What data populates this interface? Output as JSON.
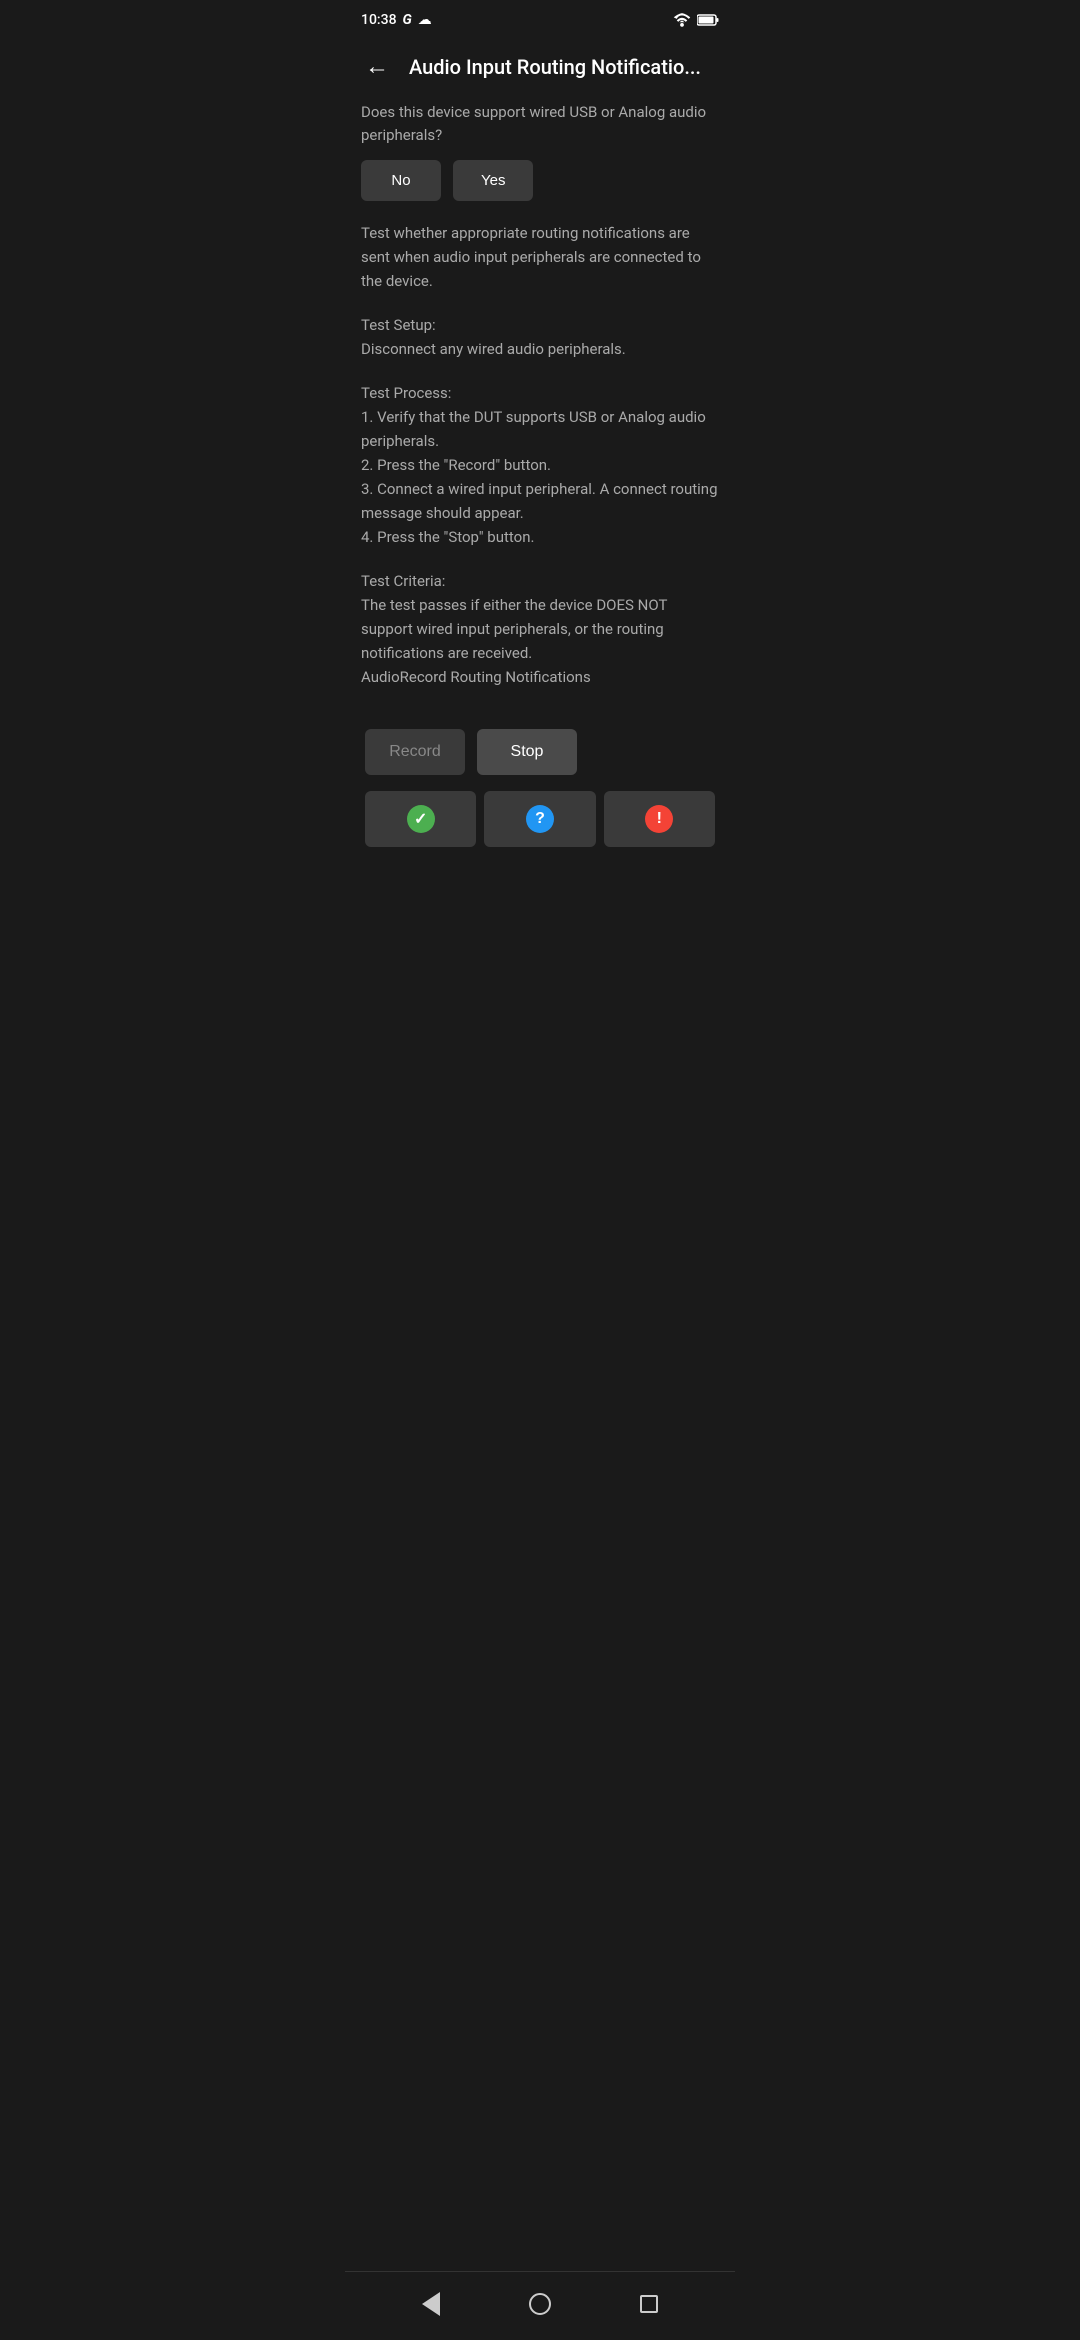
{
  "statusBar": {
    "time": "10:38",
    "googleLabel": "G",
    "cloudLabel": "☁"
  },
  "header": {
    "backLabel": "←",
    "title": "Audio Input Routing Notificatio..."
  },
  "content": {
    "questionText": "Does this device support wired USB or Analog audio peripherals?",
    "noButtonLabel": "No",
    "yesButtonLabel": "Yes",
    "descriptionText": "Test whether appropriate routing notifications are sent when audio input peripherals are connected to the device.",
    "testSetupLabel": "Test Setup:",
    "testSetupText": "Disconnect any wired audio peripherals.",
    "testProcessLabel": "Test Process:",
    "testProcessSteps": [
      "1. Verify that the DUT supports USB or Analog audio peripherals.",
      "2. Press the \"Record\" button.",
      "3. Connect a wired input peripheral. A connect routing message should appear.",
      "4. Press the \"Stop\" button."
    ],
    "testCriteriaLabel": "Test Criteria:",
    "testCriteriaText": "The test passes if either the device DOES NOT support wired input peripherals, or the routing notifications are received.",
    "testName": "AudioRecord Routing Notifications"
  },
  "actionButtons": {
    "recordLabel": "Record",
    "stopLabel": "Stop"
  },
  "resultButtons": {
    "passTitle": "Pass",
    "infoTitle": "Info",
    "failTitle": "Fail",
    "passIcon": "✓",
    "infoIcon": "?",
    "failIcon": "!"
  },
  "navBar": {
    "backTitle": "Back",
    "homeTitle": "Home",
    "recentTitle": "Recent"
  }
}
